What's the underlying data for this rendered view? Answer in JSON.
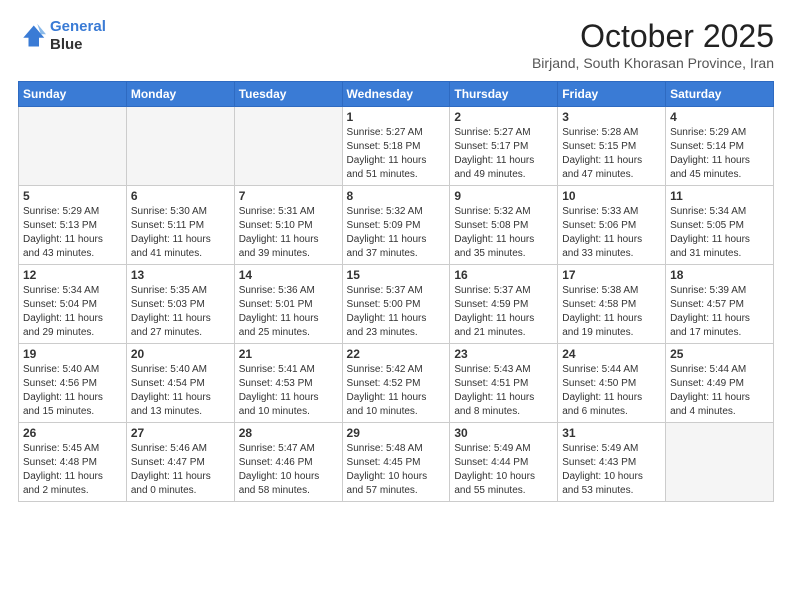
{
  "header": {
    "logo_line1": "General",
    "logo_line2": "Blue",
    "month": "October 2025",
    "location": "Birjand, South Khorasan Province, Iran"
  },
  "days": [
    "Sunday",
    "Monday",
    "Tuesday",
    "Wednesday",
    "Thursday",
    "Friday",
    "Saturday"
  ],
  "weeks": [
    [
      {
        "date": "",
        "info": ""
      },
      {
        "date": "",
        "info": ""
      },
      {
        "date": "",
        "info": ""
      },
      {
        "date": "1",
        "info": "Sunrise: 5:27 AM\nSunset: 5:18 PM\nDaylight: 11 hours\nand 51 minutes."
      },
      {
        "date": "2",
        "info": "Sunrise: 5:27 AM\nSunset: 5:17 PM\nDaylight: 11 hours\nand 49 minutes."
      },
      {
        "date": "3",
        "info": "Sunrise: 5:28 AM\nSunset: 5:15 PM\nDaylight: 11 hours\nand 47 minutes."
      },
      {
        "date": "4",
        "info": "Sunrise: 5:29 AM\nSunset: 5:14 PM\nDaylight: 11 hours\nand 45 minutes."
      }
    ],
    [
      {
        "date": "5",
        "info": "Sunrise: 5:29 AM\nSunset: 5:13 PM\nDaylight: 11 hours\nand 43 minutes."
      },
      {
        "date": "6",
        "info": "Sunrise: 5:30 AM\nSunset: 5:11 PM\nDaylight: 11 hours\nand 41 minutes."
      },
      {
        "date": "7",
        "info": "Sunrise: 5:31 AM\nSunset: 5:10 PM\nDaylight: 11 hours\nand 39 minutes."
      },
      {
        "date": "8",
        "info": "Sunrise: 5:32 AM\nSunset: 5:09 PM\nDaylight: 11 hours\nand 37 minutes."
      },
      {
        "date": "9",
        "info": "Sunrise: 5:32 AM\nSunset: 5:08 PM\nDaylight: 11 hours\nand 35 minutes."
      },
      {
        "date": "10",
        "info": "Sunrise: 5:33 AM\nSunset: 5:06 PM\nDaylight: 11 hours\nand 33 minutes."
      },
      {
        "date": "11",
        "info": "Sunrise: 5:34 AM\nSunset: 5:05 PM\nDaylight: 11 hours\nand 31 minutes."
      }
    ],
    [
      {
        "date": "12",
        "info": "Sunrise: 5:34 AM\nSunset: 5:04 PM\nDaylight: 11 hours\nand 29 minutes."
      },
      {
        "date": "13",
        "info": "Sunrise: 5:35 AM\nSunset: 5:03 PM\nDaylight: 11 hours\nand 27 minutes."
      },
      {
        "date": "14",
        "info": "Sunrise: 5:36 AM\nSunset: 5:01 PM\nDaylight: 11 hours\nand 25 minutes."
      },
      {
        "date": "15",
        "info": "Sunrise: 5:37 AM\nSunset: 5:00 PM\nDaylight: 11 hours\nand 23 minutes."
      },
      {
        "date": "16",
        "info": "Sunrise: 5:37 AM\nSunset: 4:59 PM\nDaylight: 11 hours\nand 21 minutes."
      },
      {
        "date": "17",
        "info": "Sunrise: 5:38 AM\nSunset: 4:58 PM\nDaylight: 11 hours\nand 19 minutes."
      },
      {
        "date": "18",
        "info": "Sunrise: 5:39 AM\nSunset: 4:57 PM\nDaylight: 11 hours\nand 17 minutes."
      }
    ],
    [
      {
        "date": "19",
        "info": "Sunrise: 5:40 AM\nSunset: 4:56 PM\nDaylight: 11 hours\nand 15 minutes."
      },
      {
        "date": "20",
        "info": "Sunrise: 5:40 AM\nSunset: 4:54 PM\nDaylight: 11 hours\nand 13 minutes."
      },
      {
        "date": "21",
        "info": "Sunrise: 5:41 AM\nSunset: 4:53 PM\nDaylight: 11 hours\nand 10 minutes."
      },
      {
        "date": "22",
        "info": "Sunrise: 5:42 AM\nSunset: 4:52 PM\nDaylight: 11 hours\nand 10 minutes."
      },
      {
        "date": "23",
        "info": "Sunrise: 5:43 AM\nSunset: 4:51 PM\nDaylight: 11 hours\nand 8 minutes."
      },
      {
        "date": "24",
        "info": "Sunrise: 5:44 AM\nSunset: 4:50 PM\nDaylight: 11 hours\nand 6 minutes."
      },
      {
        "date": "25",
        "info": "Sunrise: 5:44 AM\nSunset: 4:49 PM\nDaylight: 11 hours\nand 4 minutes."
      }
    ],
    [
      {
        "date": "26",
        "info": "Sunrise: 5:45 AM\nSunset: 4:48 PM\nDaylight: 11 hours\nand 2 minutes."
      },
      {
        "date": "27",
        "info": "Sunrise: 5:46 AM\nSunset: 4:47 PM\nDaylight: 11 hours\nand 0 minutes."
      },
      {
        "date": "28",
        "info": "Sunrise: 5:47 AM\nSunset: 4:46 PM\nDaylight: 10 hours\nand 58 minutes."
      },
      {
        "date": "29",
        "info": "Sunrise: 5:48 AM\nSunset: 4:45 PM\nDaylight: 10 hours\nand 57 minutes."
      },
      {
        "date": "30",
        "info": "Sunrise: 5:49 AM\nSunset: 4:44 PM\nDaylight: 10 hours\nand 55 minutes."
      },
      {
        "date": "31",
        "info": "Sunrise: 5:49 AM\nSunset: 4:43 PM\nDaylight: 10 hours\nand 53 minutes."
      },
      {
        "date": "",
        "info": ""
      }
    ]
  ]
}
